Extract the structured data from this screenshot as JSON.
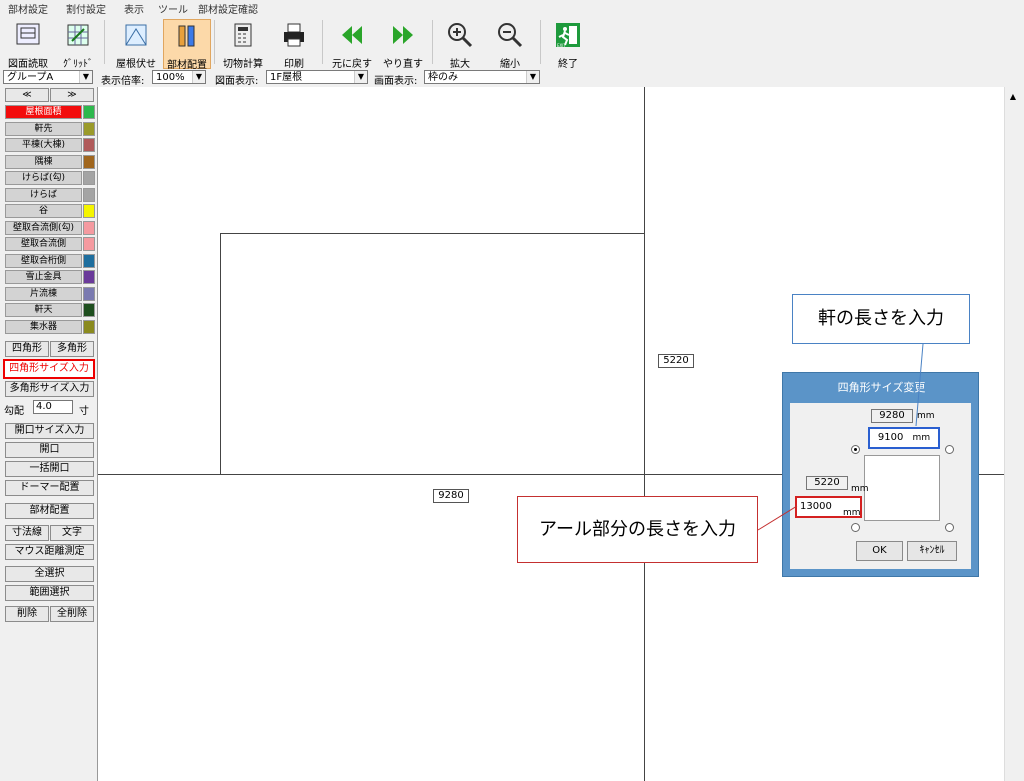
{
  "menu": [
    "部材設定",
    "割付設定",
    "表示",
    "ツール",
    "部材設定確認"
  ],
  "toolbar": {
    "buttons": [
      "図面読取",
      "ｸﾞﾘｯﾄﾞ",
      "屋根伏せ",
      "部材配置",
      "切物計算",
      "印刷",
      "元に戻す",
      "やり直す",
      "拡大",
      "縮小",
      "終了"
    ],
    "exit_sign": "EXIT"
  },
  "settings": {
    "group": "グループA",
    "scale_label": "表示倍率:",
    "scale_value": "100%",
    "drawing_label": "図面表示:",
    "drawing_value": "1F屋根",
    "screen_label": "画面表示:",
    "screen_value": "枠のみ"
  },
  "panel": {
    "prev": "≪",
    "next": "≫",
    "layers": [
      {
        "label": "屋根面積",
        "color": "#2db84d"
      },
      {
        "label": "軒先",
        "color": "#9a9a2a"
      },
      {
        "label": "平棟(大棟)",
        "color": "#b05a5a"
      },
      {
        "label": "隅棟",
        "color": "#a0661e"
      },
      {
        "label": "けらば(勾)",
        "color": "#a4a4a4"
      },
      {
        "label": "けらば",
        "color": "#a4a4a4"
      },
      {
        "label": "谷",
        "color": "#f5f500"
      },
      {
        "label": "壁取合流側(勾)",
        "color": "#f59aa0"
      },
      {
        "label": "壁取合流側",
        "color": "#f59aa0"
      },
      {
        "label": "壁取合桁側",
        "color": "#1e6e9e"
      },
      {
        "label": "雪止金具",
        "color": "#6a3a9a"
      },
      {
        "label": "片流棟",
        "color": "#7a7ab0"
      },
      {
        "label": "軒天",
        "color": "#1e4e1e"
      },
      {
        "label": "集水器",
        "color": "#8a8a1e"
      }
    ],
    "square": "四角形",
    "polygon": "多角形",
    "square_size": "四角形サイズ入力",
    "polygon_size": "多角形サイズ入力",
    "slope_label": "勾配",
    "slope_value": "4.0",
    "slope_unit": "寸",
    "opening_size": "開口サイズ入力",
    "opening": "開口",
    "bulk_opening": "一括開口",
    "dormer": "ドーマー配置",
    "member_place": "部材配置",
    "dim_line": "寸法線",
    "text": "文字",
    "mouse_measure": "マウス距離測定",
    "select_all": "全選択",
    "range_select": "範囲選択",
    "delete": "削除",
    "delete_all": "全削除"
  },
  "canvas": {
    "dim_right": "5220",
    "dim_bottom": "9280"
  },
  "dialog": {
    "title": "四角形サイズ変更",
    "top_value": "9280",
    "top_input": "9100",
    "left_value": "5220",
    "left_input": "13000",
    "unit": "mm",
    "ok": "OK",
    "cancel": "ｷｬﾝｾﾙ"
  },
  "callouts": {
    "eave": "軒の長さを入力",
    "arc": "アール部分の長さを入力"
  }
}
